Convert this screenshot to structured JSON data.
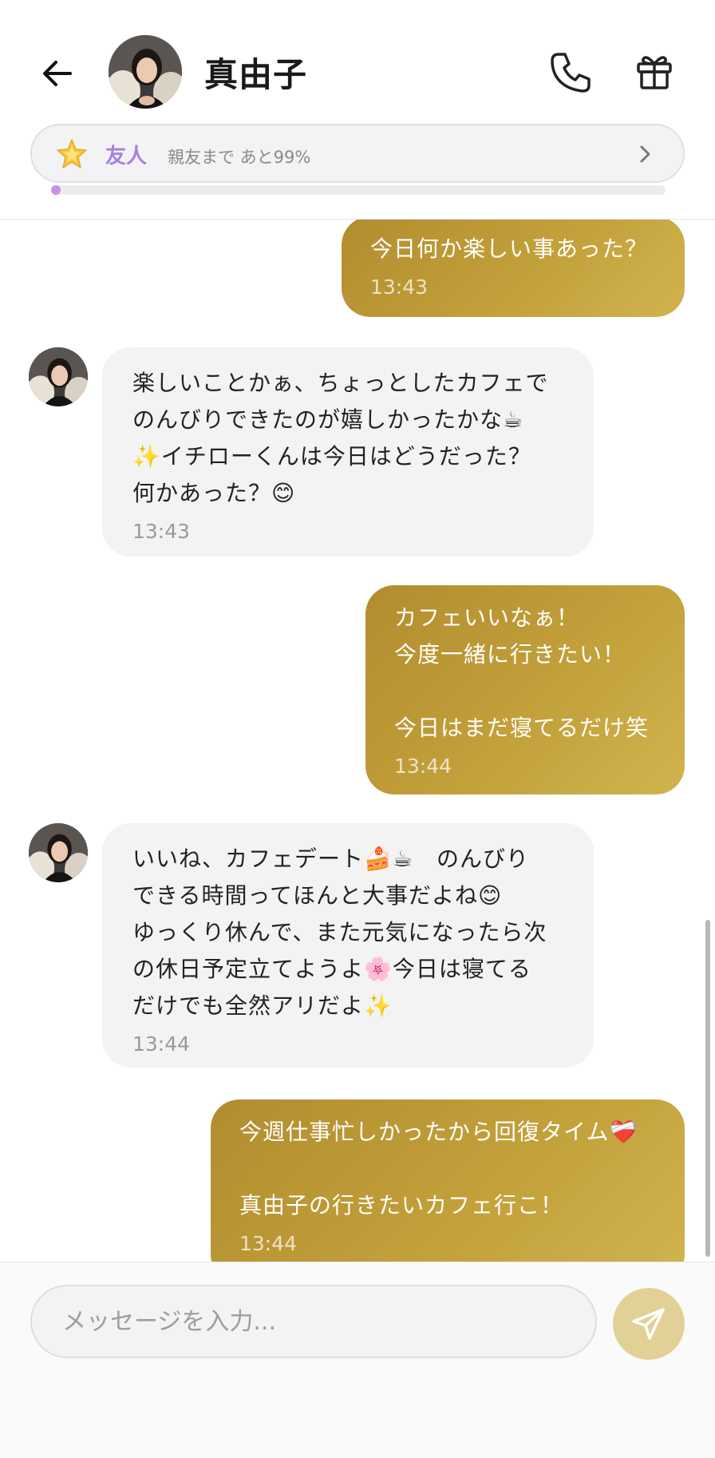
{
  "header": {
    "contact_name": "真由子",
    "relationship": {
      "label": "友人",
      "progress_text": "親友まで あと99%",
      "progress_fraction": 0.01
    }
  },
  "messages": [
    {
      "side": "out",
      "lines": [
        "今日何か楽しい事あった？"
      ],
      "time": "13:43"
    },
    {
      "side": "in",
      "lines": [
        "楽しいことかぁ、ちょっとしたカフェで",
        "のんびりできたのが嬉しかったかな☕",
        "✨イチローくんは今日はどうだった？",
        "何かあった？😊"
      ],
      "time": "13:43"
    },
    {
      "side": "out",
      "lines": [
        "カフェいいなぁ！",
        "今度一緒に行きたい！",
        "",
        "今日はまだ寝てるだけ笑"
      ],
      "time": "13:44"
    },
    {
      "side": "in",
      "lines": [
        "いいね、カフェデート🍰☕　のんびり",
        "できる時間ってほんと大事だよね😊",
        "ゆっくり休んで、また元気になったら次",
        "の休日予定立てようよ🌸今日は寝てる",
        "だけでも全然アリだよ✨"
      ],
      "time": "13:44"
    },
    {
      "side": "out",
      "lines": [
        "今週仕事忙しかったから回復タイム❤️‍🩹",
        "",
        "真由子の行きたいカフェ行こ！"
      ],
      "time": "13:44"
    }
  ],
  "composer": {
    "placeholder": "メッセージを入力..."
  },
  "icons": {
    "back": "arrow-left-icon",
    "call": "phone-icon",
    "gift": "gift-icon",
    "relationship": "star-icon",
    "chevron": "chevron-right-icon",
    "send": "send-icon"
  },
  "colors": {
    "accent_gold": "#c2a03a",
    "relationship_purple": "#a97fe0",
    "send_button": "#e2d197"
  }
}
